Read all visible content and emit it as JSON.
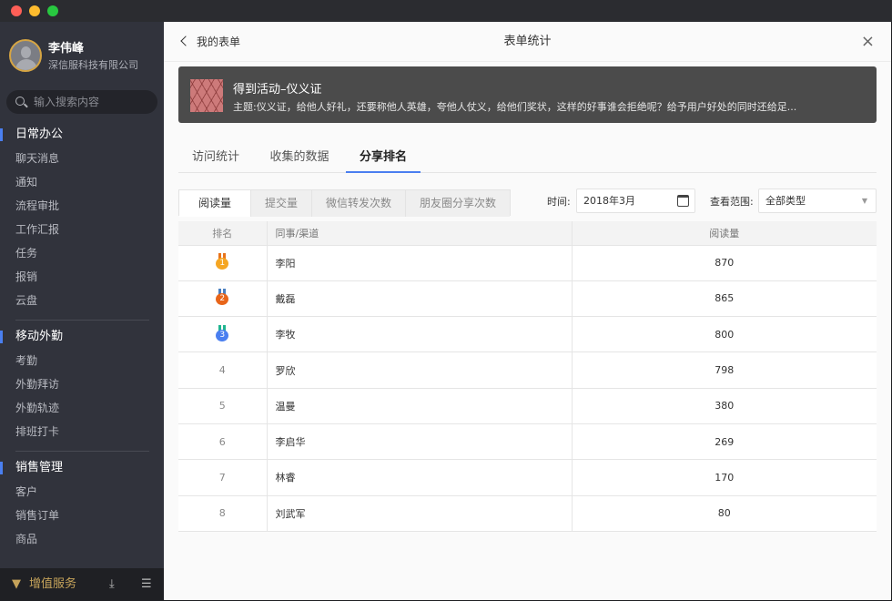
{
  "sidebar": {
    "user": {
      "name": "李伟峰",
      "company": "深信服科技有限公司"
    },
    "search_placeholder": "输入搜索内容",
    "groups": [
      {
        "title": "日常办公",
        "items": [
          "聊天消息",
          "通知",
          "流程审批",
          "工作汇报",
          "任务",
          "报销",
          "云盘"
        ]
      },
      {
        "title": "移动外勤",
        "items": [
          "考勤",
          "外勤拜访",
          "外勤轨迹",
          "排班打卡"
        ]
      },
      {
        "title": "销售管理",
        "items": [
          "客户",
          "销售订单",
          "商品"
        ]
      }
    ],
    "footer": {
      "label": "增值服务",
      "icons": [
        "gem-icon",
        "download-icon",
        "menu-icon"
      ]
    }
  },
  "header": {
    "back_label": "我的表单",
    "title": "表单统计",
    "close": "×"
  },
  "banner": {
    "title": "得到活动–仪义证",
    "desc": "主题:仪义证，给他人好礼，还要称他人英雄，夸他人仗义，给他们奖状，这样的好事谁会拒绝呢？给予用户好处的同时还给足..."
  },
  "tabs": [
    "访问统计",
    "收集的数据",
    "分享排名"
  ],
  "active_tab": 2,
  "subtabs": [
    "阅读量",
    "提交量",
    "微信转发次数",
    "朋友圈分享次数"
  ],
  "filters": {
    "time_label": "时间:",
    "time_value": "2018年3月",
    "range_label": "查看范围:",
    "range_value": "全部类型"
  },
  "table": {
    "headers": [
      "排名",
      "同事/渠道",
      "阅读量"
    ],
    "rows": [
      {
        "rank": "1",
        "name": "李阳",
        "value": "870"
      },
      {
        "rank": "2",
        "name": "戴磊",
        "value": "865"
      },
      {
        "rank": "3",
        "name": "李牧",
        "value": "800"
      },
      {
        "rank": "4",
        "name": "罗欣",
        "value": "798"
      },
      {
        "rank": "5",
        "name": "温曼",
        "value": "380"
      },
      {
        "rank": "6",
        "name": "李启华",
        "value": "269"
      },
      {
        "rank": "7",
        "name": "林睿",
        "value": "170"
      },
      {
        "rank": "8",
        "name": "刘武军",
        "value": "80"
      }
    ]
  },
  "colors": {
    "accent": "#4a7ff0",
    "gold": "#f5a623",
    "silver": "#e8651a",
    "bronze": "#4a7ff0"
  }
}
